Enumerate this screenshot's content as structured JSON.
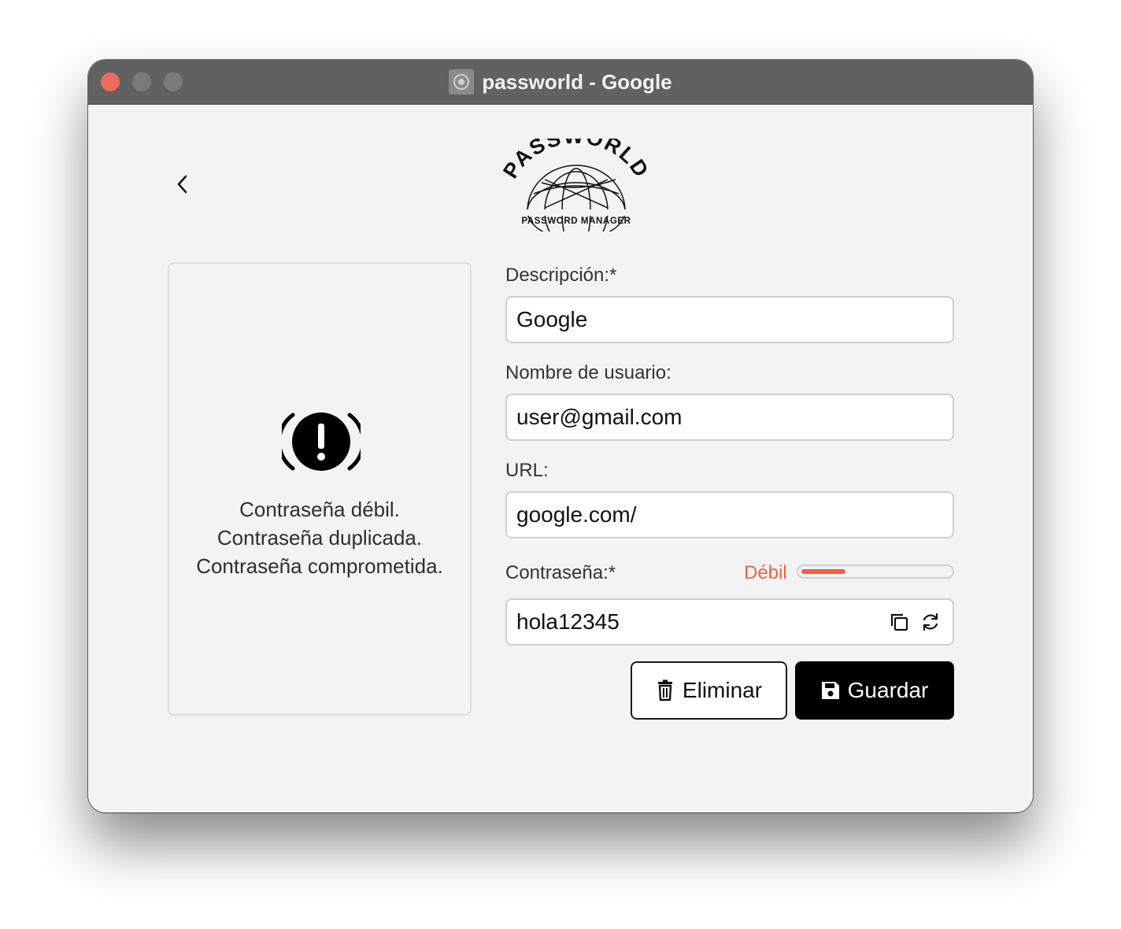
{
  "window": {
    "title": "passworld - Google"
  },
  "logo": {
    "arc_text": "PASSWORLD",
    "subtitle": "PASSWORD MANAGER"
  },
  "status": {
    "icon": "exclamation-alert-icon",
    "lines": [
      "Contraseña débil.",
      "Contraseña duplicada.",
      "Contraseña comprometida."
    ]
  },
  "form": {
    "description": {
      "label": "Descripción:*",
      "value": "Google"
    },
    "username": {
      "label": "Nombre de usuario:",
      "value": "user@gmail.com"
    },
    "url": {
      "label": "URL:",
      "value": "google.com/"
    },
    "password": {
      "label": "Contraseña:*",
      "value": "hola12345",
      "strength_label": "Débil",
      "strength_fraction": 0.3,
      "strength_color": "#ee6148"
    }
  },
  "buttons": {
    "delete_label": "Eliminar",
    "save_label": "Guardar"
  },
  "colors": {
    "accent_weak": "#ee6148",
    "primary_button": "#000000",
    "titlebar": "#616161"
  }
}
